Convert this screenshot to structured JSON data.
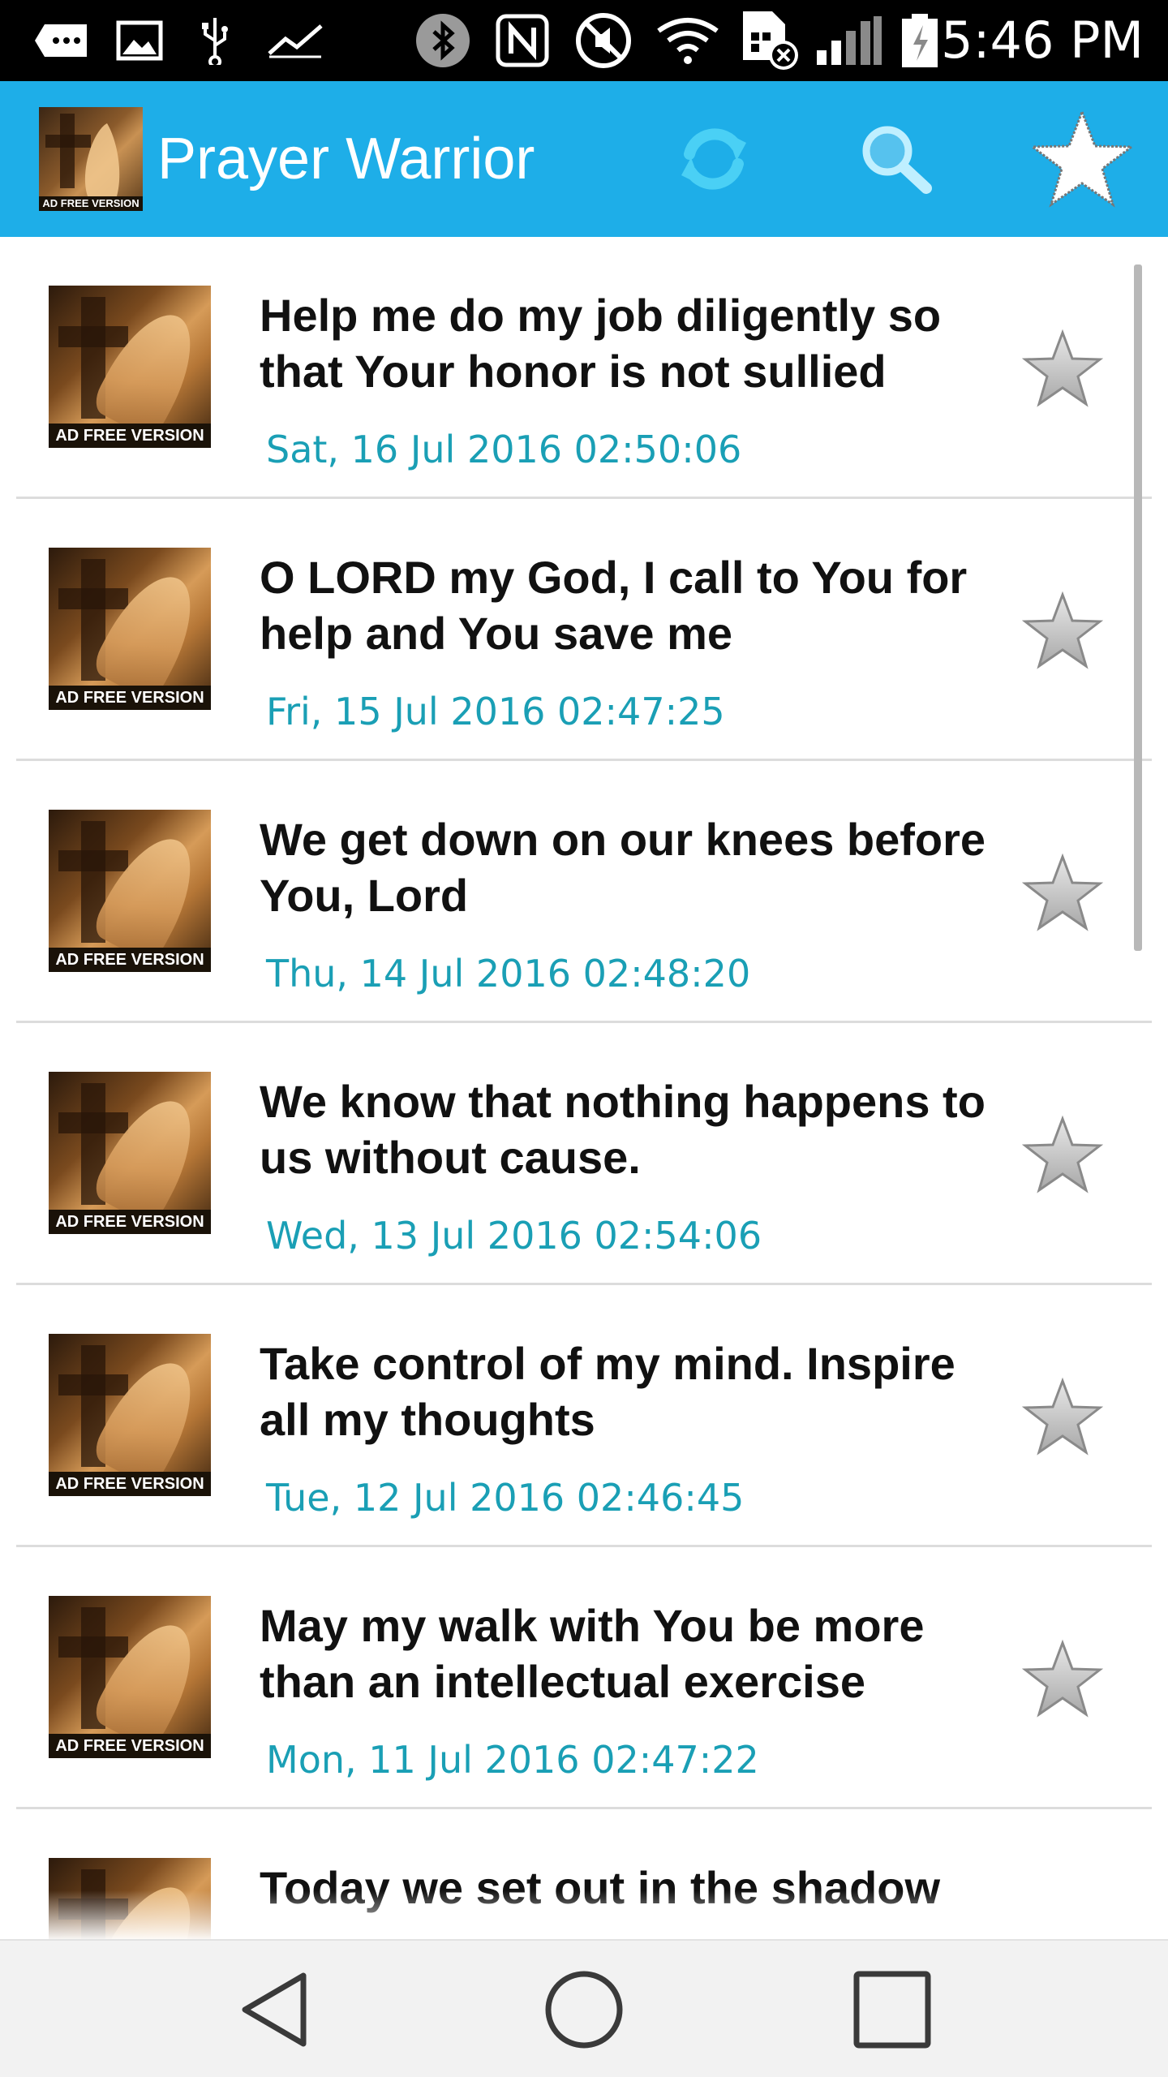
{
  "status_bar": {
    "time": "5:46 PM",
    "icons": [
      "more-icon",
      "image-icon",
      "usb-icon",
      "activity-icon",
      "bluetooth-icon",
      "nfc-icon",
      "mute-icon",
      "wifi-icon",
      "sim-icon",
      "signal-icon",
      "battery-icon"
    ]
  },
  "app_bar": {
    "title": "Prayer Warrior",
    "logo_tag": "AD FREE VERSION",
    "actions": [
      "refresh-icon",
      "search-icon",
      "favorites-star-icon"
    ]
  },
  "list": {
    "thumb_tag": "AD FREE VERSION",
    "items": [
      {
        "title": "Help me do my job diligently so that Your honor is not sullied",
        "date": "Sat, 16 Jul 2016 02:50:06"
      },
      {
        "title": "O LORD my God, I call to You for help and You save me",
        "date": "Fri, 15 Jul 2016 02:47:25"
      },
      {
        "title": "We get down on our knees before You, Lord",
        "date": "Thu, 14 Jul 2016 02:48:20"
      },
      {
        "title": "We know that nothing happens to us without cause.",
        "date": "Wed, 13 Jul 2016 02:54:06"
      },
      {
        "title": "Take control of my mind. Inspire all my thoughts",
        "date": "Tue, 12 Jul 2016 02:46:45"
      },
      {
        "title": "May my walk with You be more than an intellectual exercise",
        "date": "Mon, 11 Jul 2016 02:47:22"
      },
      {
        "title": "Today we set out in the shadow",
        "date": ""
      }
    ]
  },
  "colors": {
    "app_bar": "#1eaee8",
    "date_text": "#1a9fb5",
    "title_text": "#111111",
    "divider": "#dcdcdc"
  },
  "nav_bar": {
    "buttons": [
      "back-icon",
      "home-icon",
      "recents-icon"
    ]
  }
}
